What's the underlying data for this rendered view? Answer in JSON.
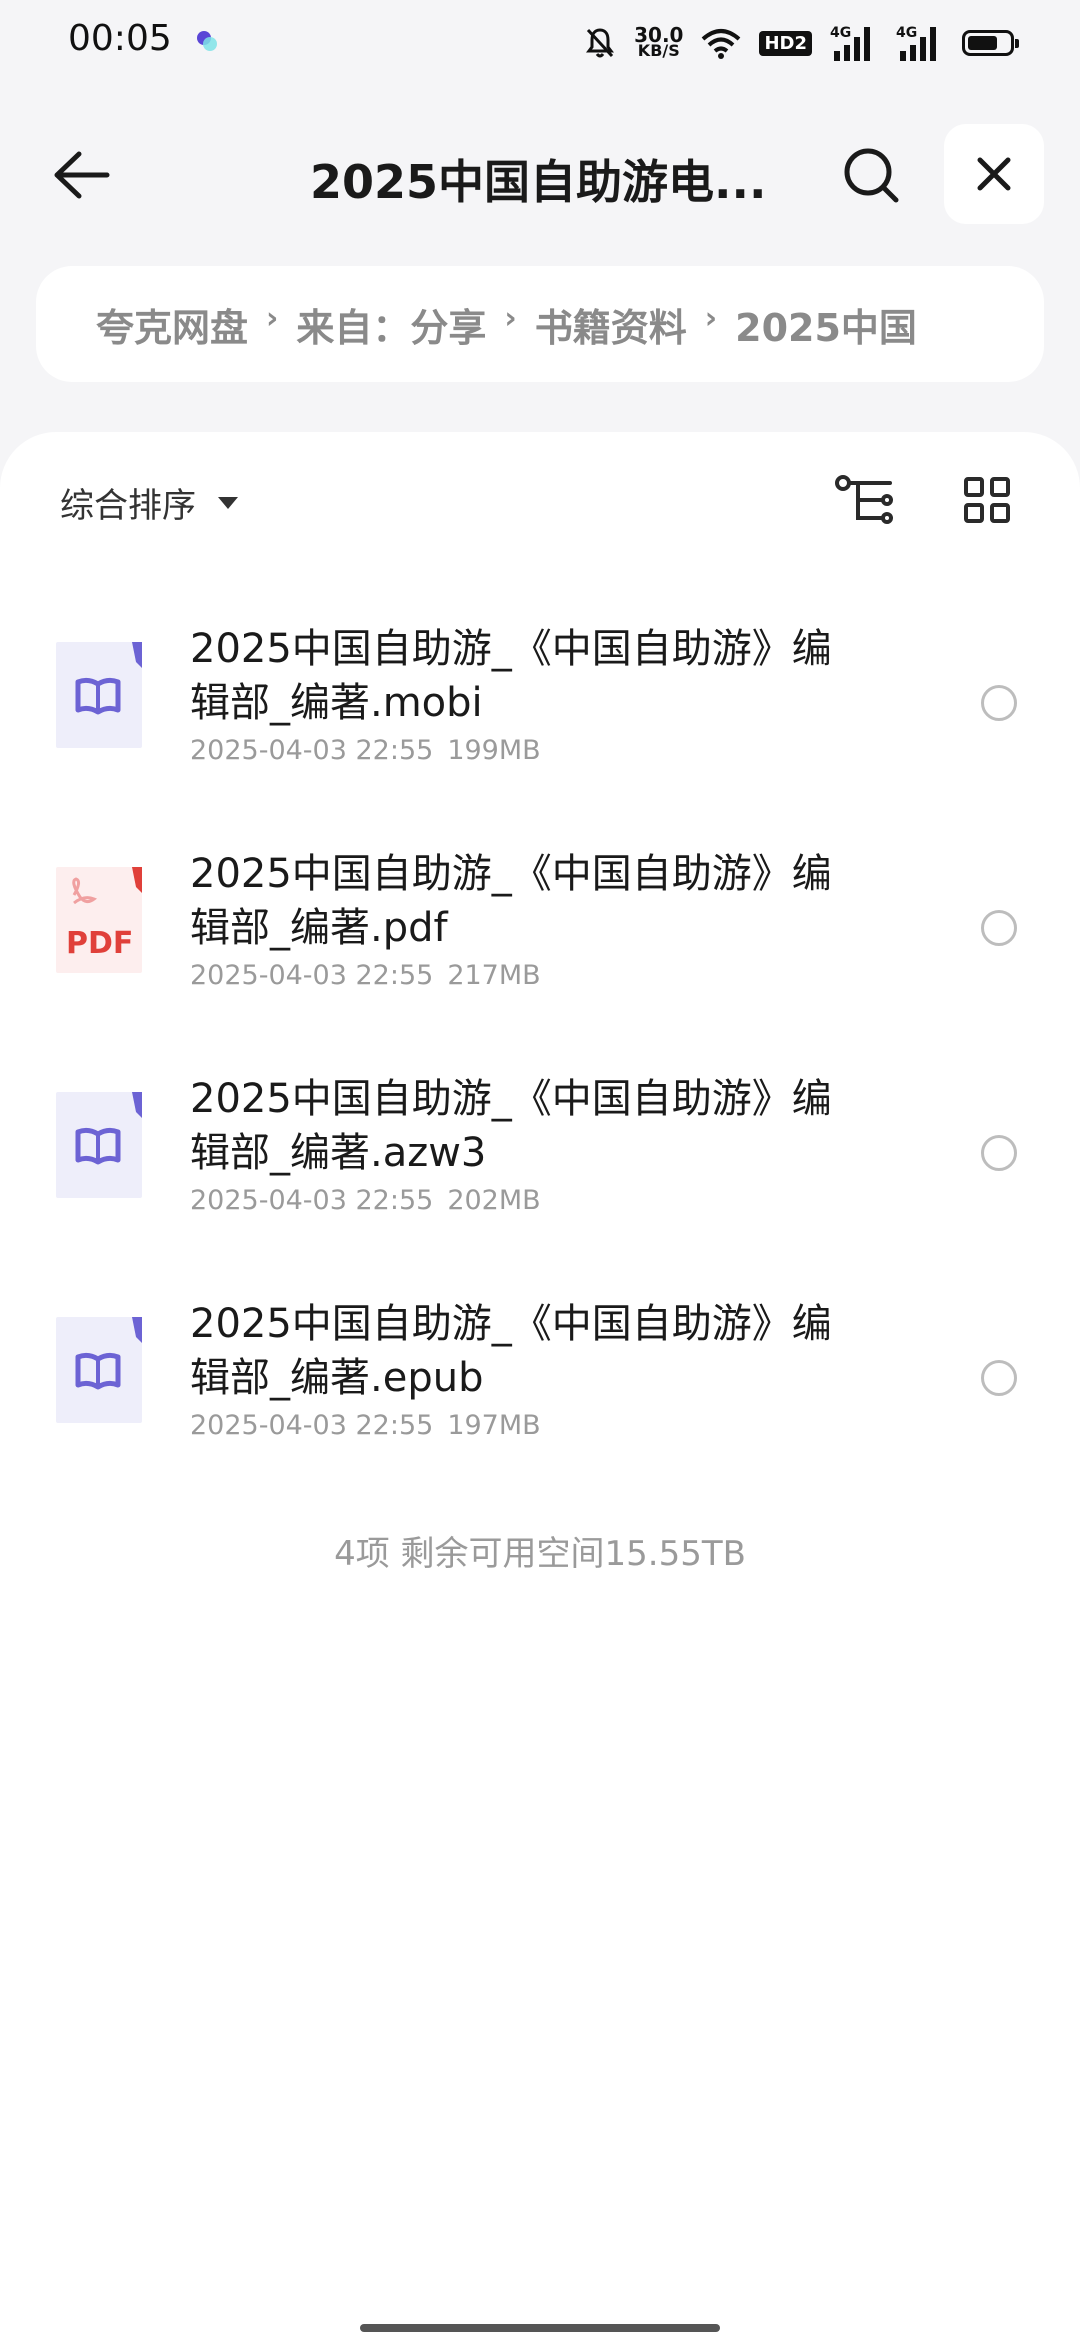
{
  "status_bar": {
    "time": "00:05",
    "net_speed_value": "30.0",
    "net_speed_unit": "KB/S",
    "hd_label": "HD2",
    "signal_1_label": "4G",
    "signal_2_label": "4G",
    "icons": [
      "app-dot-icon",
      "mute-bell-icon",
      "wifi-icon",
      "signal-icon",
      "battery-icon"
    ]
  },
  "header": {
    "title": "2025中国自助游电..."
  },
  "breadcrumb": {
    "items": [
      "夸克网盘",
      "来自：分享",
      "书籍资料",
      "2025中国"
    ]
  },
  "toolbar": {
    "sort_label": "综合排序"
  },
  "files": [
    {
      "name": "2025中国自助游_《中国自助游》编辑部_编著.mobi",
      "date": "2025-04-03 22:55",
      "size": "199MB",
      "type": "book"
    },
    {
      "name": "2025中国自助游_《中国自助游》编辑部_编著.pdf",
      "date": "2025-04-03 22:55",
      "size": "217MB",
      "type": "pdf",
      "type_label": "PDF"
    },
    {
      "name": "2025中国自助游_《中国自助游》编辑部_编著.azw3",
      "date": "2025-04-03 22:55",
      "size": "202MB",
      "type": "book"
    },
    {
      "name": "2025中国自助游_《中国自助游》编辑部_编著.epub",
      "date": "2025-04-03 22:55",
      "size": "197MB",
      "type": "book"
    }
  ],
  "footer": {
    "summary": "4项 剩余可用空间15.55TB"
  },
  "colors": {
    "book_icon": "#6c63d4",
    "book_icon_bg": "#eeeefa",
    "pdf_icon": "#e0403a",
    "pdf_icon_bg": "#fdeeee"
  }
}
